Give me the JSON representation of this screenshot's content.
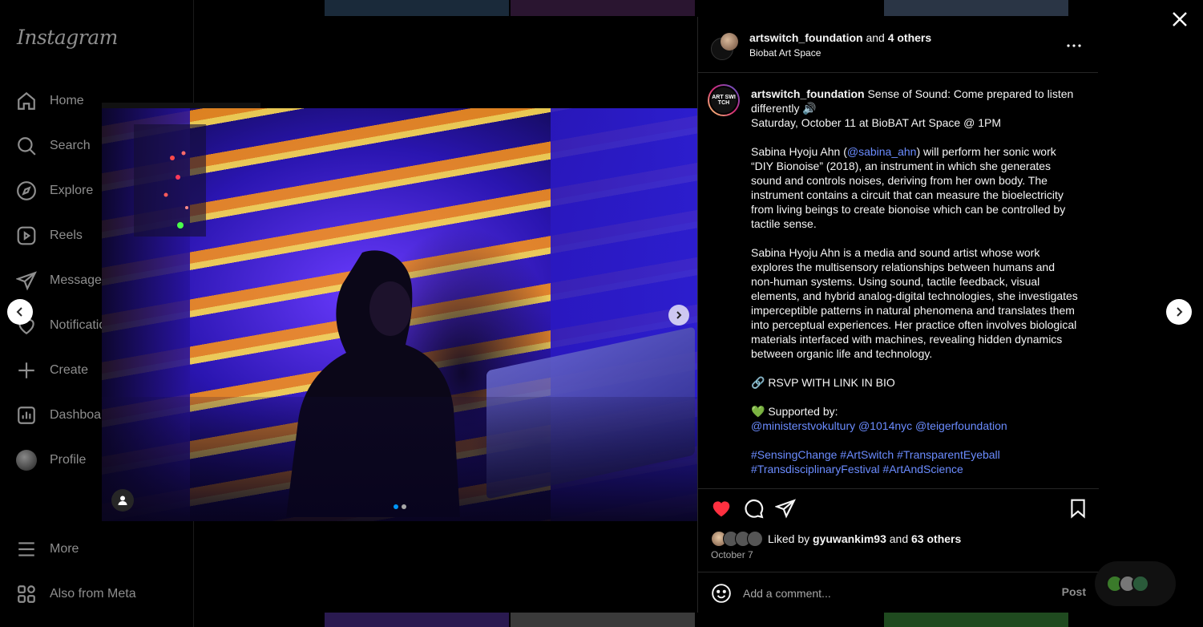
{
  "sidebar": {
    "logo": "Instagram",
    "items": [
      {
        "label": "Home",
        "icon": "home-icon"
      },
      {
        "label": "Search",
        "icon": "search-icon"
      },
      {
        "label": "Explore",
        "icon": "explore-icon"
      },
      {
        "label": "Reels",
        "icon": "reels-icon"
      },
      {
        "label": "Messages",
        "icon": "messages-icon"
      },
      {
        "label": "Notifications",
        "icon": "heart-icon"
      },
      {
        "label": "Create",
        "icon": "plus-icon"
      },
      {
        "label": "Dashboard",
        "icon": "dashboard-icon"
      },
      {
        "label": "Profile",
        "icon": "avatar"
      }
    ],
    "more_label": "More",
    "also_from_label": "Also from Meta"
  },
  "post": {
    "header": {
      "author": "artswitch_foundation",
      "and": "and",
      "collab_count": "4 others",
      "location": "Biobat Art Space"
    },
    "caption": {
      "avatar_text": "ART SWI TCH",
      "author": "artswitch_foundation",
      "line1": "Sense of Sound: Come prepared to listen differently 🔊",
      "line2": "Saturday, October 11 at BioBAT Art Space @ 1PM",
      "p2_pre": "Sabina Hyoju Ahn (",
      "p2_mention": "@sabina_ahn",
      "p2_post": ") will perform her sonic work “DIY Bionoise” (2018), an instrument in which she generates sound and controls noises, deriving from her own body. The instrument contains a circuit that can measure the bioelectricity from living beings to create bionoise which can be controlled by tactile sense.",
      "p3": "Sabina Hyoju Ahn is a media and sound artist whose work explores the multisensory relationships between humans and non-human systems. Using sound, tactile feedback, visual elements, and hybrid analog-digital technologies, she investigates imperceptible patterns in natural phenomena and translates them into perceptual experiences. Her practice often involves biological materials interfaced with machines, revealing hidden dynamics between organic life and technology.",
      "rsvp": "🔗 RSVP WITH LINK IN BIO",
      "supported": "💚 Supported by:",
      "sponsors": "@ministerstvokultury @1014nyc @teigerfoundation",
      "hashtags1": "#SensingChange #ArtSwitch #TransparentEyeball",
      "hashtags2": "#TransdisciplinaryFestival #ArtAndScience"
    },
    "likes": {
      "prefix": "Liked by",
      "user": "gyuwankim93",
      "and": "and",
      "others": "63 others"
    },
    "date": "October 7",
    "comment": {
      "placeholder": "Add a comment...",
      "post_label": "Post"
    },
    "carousel": {
      "current": 1,
      "total": 2
    }
  },
  "colors": {
    "accent": "#0095f6",
    "like": "#ff3040",
    "link": "#6b8cff"
  }
}
